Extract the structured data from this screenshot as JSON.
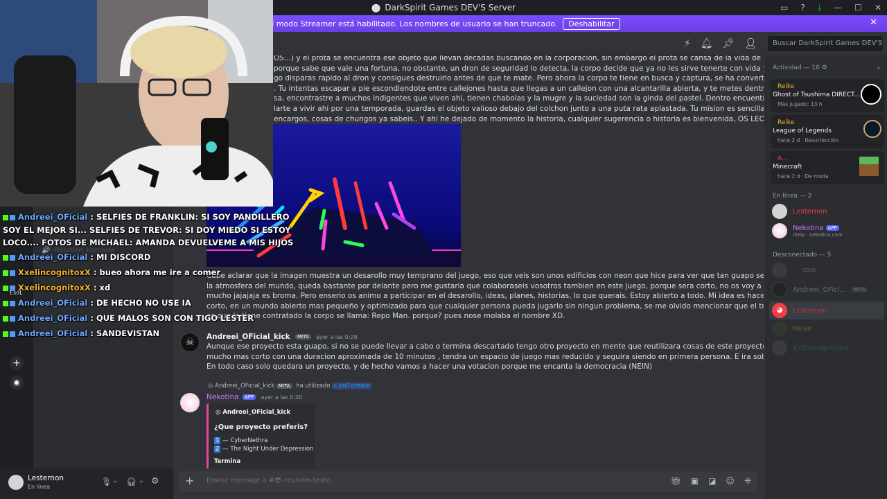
{
  "window": {
    "title": "DarkSpirit Games DEV'S Server"
  },
  "banner": {
    "text": "El modo Streamer está habilitado. Los nombres de usuario se han truncado.",
    "button": "Deshabilitar"
  },
  "search": {
    "placeholder": "Buscar DarkSpirit Games DEV'S ..."
  },
  "messages": {
    "para1": [
      "OS...) y el prota se encuentra ese objeto que llevan decadas buscando en la corporacion, sin embargo el prota se cansa de la vida de mierda que tiene",
      "porque sabe que vale una fortuna, no obstante,  un dron de seguridad lo detecta, la corpo decide que ya no les sirve tenerte con vida y deciden",
      "go disparas rapido al dron y consigues destruirlo antes de que te mate. Pero ahora la corpo te tiene en busca y captura, se ha convertido en tu",
      ". Tu intentas escapar a pie escondiendote entre callejones hasta que llegas a un callejon con una alcantarilla abierta, y te metes dentro para",
      "sa, encontrastre a muchos indigentes que viven ahi, tienen chabolas y la mugre y la suciedad son la ginda del pastel. Dentro encuentras un colchon",
      "larte a vivir ahi por una temporada, guardas el objeto valioso debajo del colchon junto a una puta rata aplastada. Tu mision es sencilla, buscar",
      " encargos, cosas de chungos ya sabeis.. Y ahi he dejado de momento la historia, cualquier sugerencia o historia es bienvenida, OS LEO!!"
    ],
    "para2": [
      "Cabe aclarar que la imagen muestra un desarollo muy temprano del juego, eso que veis son unos edificios con neon que hice para ver que tan guapo se veria y para preparar",
      "la atmosfera del mundo, queda bastante por delante pero me gustaria que colaboraseis vosotros tambien en este juego, porque sera corto, no os voy a hacer trabajar",
      "mucho jajajaja es broma. Pero enserio os animo a participar en el desarollo, ideas, planes, historias, lo que querais. Estoy abierto a todo. Mi idea es hacer un cyberpunk pero",
      "corto, en un mundo abierto mas pequeño y optimizado para que cualquier persona pueda jugarlo sin ningun problema, se me olvido mencionar que el trabajo del prota",
      "es que lo tiene contratado la corpo se llama: Repo Man. porque? pues nose molaba el nombre XD."
    ],
    "msg3": {
      "author": "Andreei_OFicial_kick",
      "badge": "MITA",
      "time": "ayer a las 0:28",
      "lines": [
        "Aunque ese proyecto esta guapo, si no se puede llevar a cabo o termina descartado tengo otro proyecto en mente que reutilizara cosas de este proyecto, el proyecto seria",
        "mucho mas corto con una duracion aproximada de 10 minutos , tendra un espacio de juego mas reducido y seguira siendo en primera persona. E ira sobre algo mas realista.",
        "En todo caso solo quedara un proyecto, y de hecho vamos a hacer una votacion porque me encanta la democracia (NEIN)"
      ]
    },
    "reply": {
      "author": "Andreei_OFicial_kick",
      "badge": "MITA",
      "text": "ha utilizado",
      "command": "poll create"
    },
    "msg4": {
      "author": "Nekotina",
      "badge": "APP",
      "time": "ayer a las 0:30",
      "embed": {
        "author": "Andreei_OFicial_kick",
        "title": "¿Que proyecto preferis?",
        "options": [
          {
            "n": "1",
            "text": "— CyberNethra"
          },
          {
            "n": "2",
            "text": "— The Night Under Depression"
          }
        ],
        "footer": "Termina"
      }
    }
  },
  "members": {
    "activity_header": "Actividad — 10",
    "activities": [
      {
        "user": "Reike",
        "game": "Ghost of Tsushima DIRECT...",
        "meta": "Más jugado: 13 h"
      },
      {
        "user": "Reike",
        "game": "League of Legends",
        "meta": "hace 2 d  · Resurrección"
      },
      {
        "user": "A...",
        "game": "Minecraft",
        "meta": "hace 2 d  · De moda"
      }
    ],
    "online_header": "En línea — 2",
    "online": [
      {
        "name": "Lesternon"
      },
      {
        "name": "Nekotina",
        "badge": "APP",
        "status": "/help · nekotina.com"
      }
    ],
    "offline_header": "Desconectado — 5",
    "offline": [
      {
        "name": "SDLG"
      },
      {
        "name": "Andreei_OFici...",
        "badge": "MITA"
      },
      {
        "name": "Lesternon"
      },
      {
        "name": "Reike"
      },
      {
        "name": "XxElincognitoxX"
      }
    ]
  },
  "user": {
    "name": "Lesternon",
    "status": "En línea"
  },
  "input": {
    "placeholder": "Enviar mensaje a #😎-reunion-texto"
  },
  "overlay": {
    "line1_user": "Andreei_OFicial",
    "line1_text": ": SELFIES DE FRANKLIN: SI SOY PANDILLERO",
    "line1b": "SOY EL MEJOR SI... SELFIES DE TREVOR: SI DOY MIEDO SI ESTOY",
    "line1c": "LOCO.... FOTOS DE MICHAEL: AMANDA DEVUELVEME A MIS HIJOS",
    "lines": [
      {
        "user": "Andreei_OFicial",
        "text": ": MI DISCORD"
      },
      {
        "user": "XxelincognitoxX",
        "text": ": bueo ahora me ire a comer"
      },
      {
        "user": "XxelincognitoxX",
        "text": ": xd"
      },
      {
        "user": "Andreei_OFicial",
        "text": ": DE HECHO NO USE IA"
      },
      {
        "user": "Andreei_OFicial",
        "text": ": QUE MALOS SON CON TIGO LESTER"
      },
      {
        "user": "Andreei_OFicial",
        "text": ": SANDEVISTAN"
      }
    ],
    "voice_label": "-Reunion_llamada",
    "small_label": "EsdL"
  }
}
